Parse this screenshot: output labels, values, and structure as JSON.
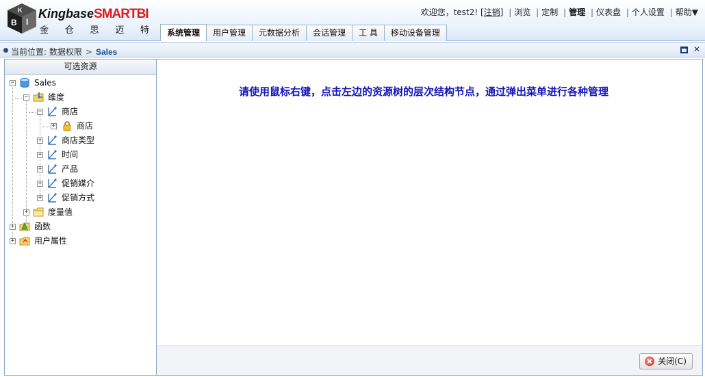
{
  "logo": {
    "brand": "Kingbase",
    "brand_accent": "SMARTBI",
    "chinese": [
      "金",
      "仓",
      "思",
      "迈",
      "特"
    ]
  },
  "topbar": {
    "welcome": "欢迎您，test2!",
    "logout": "注销",
    "links": [
      "浏览",
      "定制",
      "管理",
      "仪表盘",
      "个人设置"
    ],
    "active_link": "管理",
    "help": "帮助▼"
  },
  "tabs": [
    "系统管理",
    "用户管理",
    "元数据分析",
    "会话管理",
    "工 具",
    "移动设备管理"
  ],
  "breadcrumb": {
    "prefix": "当前位置:",
    "parent": "数据权限",
    "arrow": ">",
    "current": "Sales"
  },
  "left_panel": {
    "title": "可选资源",
    "tree": [
      {
        "label": "Sales",
        "icon": "database-icon"
      },
      {
        "label": "维度",
        "icon": "dimension-folder-icon"
      },
      {
        "label": "商店",
        "icon": "hierarchy-icon"
      },
      {
        "label": "商店",
        "icon": "lock-icon"
      },
      {
        "label": "商店类型",
        "icon": "hierarchy-icon"
      },
      {
        "label": "时间",
        "icon": "hierarchy-icon"
      },
      {
        "label": "产品",
        "icon": "hierarchy-icon"
      },
      {
        "label": "促销媒介",
        "icon": "hierarchy-icon"
      },
      {
        "label": "促销方式",
        "icon": "hierarchy-icon"
      },
      {
        "label": "度量值",
        "icon": "folder-icon"
      },
      {
        "label": "函数",
        "icon": "function-folder-icon"
      },
      {
        "label": "用户属性",
        "icon": "user-attribute-folder-icon"
      }
    ]
  },
  "main": {
    "hint": "请使用鼠标右键，点击左边的资源树的层次结构节点，通过弹出菜单进行各种管理",
    "close_button": "关闭(C)"
  },
  "colors": {
    "hint": "#1414b8",
    "crumb_current": "#1b4ea0",
    "brand_accent": "#d81e1e"
  }
}
